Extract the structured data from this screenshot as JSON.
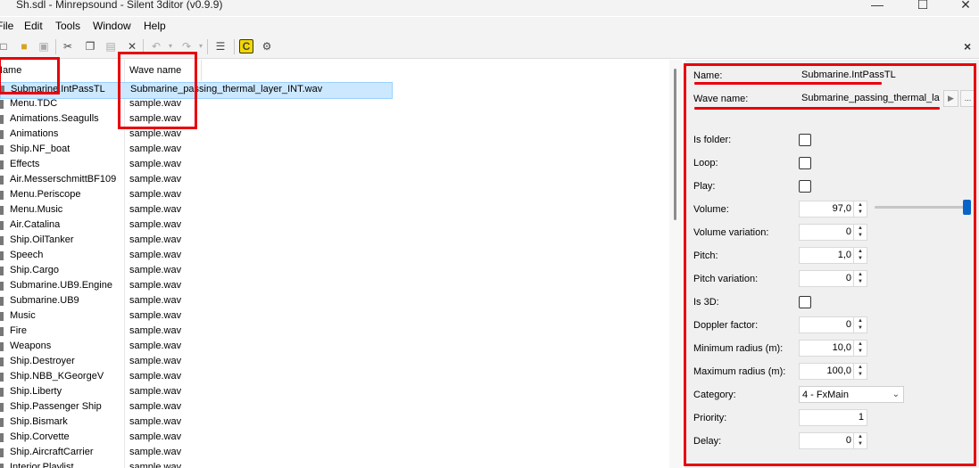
{
  "window": {
    "title": "Sh.sdl - Minrepsound - Silent 3ditor (v0.9.9)",
    "minimize": "—",
    "maximize": "☐",
    "close": "✕"
  },
  "menu": [
    "File",
    "Edit",
    "Tools",
    "Window",
    "Help"
  ],
  "panel_close": "×",
  "list": {
    "columns": [
      "Name",
      "Wave name"
    ],
    "rows": [
      {
        "name": "Submarine.IntPassTL",
        "wave": "Submarine_passing_thermal_layer_INT.wav",
        "selected": true
      },
      {
        "name": "Menu.TDC",
        "wave": "sample.wav"
      },
      {
        "name": "Animations.Seagulls",
        "wave": "sample.wav"
      },
      {
        "name": "Animations",
        "wave": "sample.wav"
      },
      {
        "name": "Ship.NF_boat",
        "wave": "sample.wav"
      },
      {
        "name": "Effects",
        "wave": "sample.wav"
      },
      {
        "name": "Air.MesserschmittBF109",
        "wave": "sample.wav"
      },
      {
        "name": "Menu.Periscope",
        "wave": "sample.wav"
      },
      {
        "name": "Menu.Music",
        "wave": "sample.wav"
      },
      {
        "name": "Air.Catalina",
        "wave": "sample.wav"
      },
      {
        "name": "Ship.OilTanker",
        "wave": "sample.wav"
      },
      {
        "name": "Speech",
        "wave": "sample.wav"
      },
      {
        "name": "Ship.Cargo",
        "wave": "sample.wav"
      },
      {
        "name": "Submarine.UB9.Engine",
        "wave": "sample.wav"
      },
      {
        "name": "Submarine.UB9",
        "wave": "sample.wav"
      },
      {
        "name": "Music",
        "wave": "sample.wav"
      },
      {
        "name": "Fire",
        "wave": "sample.wav"
      },
      {
        "name": "Weapons",
        "wave": "sample.wav"
      },
      {
        "name": "Ship.Destroyer",
        "wave": "sample.wav"
      },
      {
        "name": "Ship.NBB_KGeorgeV",
        "wave": "sample.wav"
      },
      {
        "name": "Ship.Liberty",
        "wave": "sample.wav"
      },
      {
        "name": "Ship.Passenger Ship",
        "wave": "sample.wav"
      },
      {
        "name": "Ship.Bismark",
        "wave": "sample.wav"
      },
      {
        "name": "Ship.Corvette",
        "wave": "sample.wav"
      },
      {
        "name": "Ship.AircraftCarrier",
        "wave": "sample.wav"
      },
      {
        "name": "Interior.Playlist",
        "wave": "sample.wav"
      }
    ]
  },
  "props": {
    "name_label": "Name:",
    "name_value": "Submarine.IntPassTL",
    "wave_label": "Wave name:",
    "wave_value": "Submarine_passing_thermal_layer_INT.wav",
    "play_btn": "▶",
    "browse_btn": "...",
    "is_folder_label": "Is folder:",
    "loop_label": "Loop:",
    "play_label": "Play:",
    "volume_label": "Volume:",
    "volume_value": "97,0",
    "volume_slider_level": 0.97,
    "volvar_label": "Volume variation:",
    "volvar_value": "0",
    "pitch_label": "Pitch:",
    "pitch_value": "1,0",
    "pitchvar_label": "Pitch variation:",
    "pitchvar_value": "0",
    "is3d_label": "Is 3D:",
    "doppler_label": "Doppler factor:",
    "doppler_value": "0",
    "minrad_label": "Minimum radius (m):",
    "minrad_value": "10,0",
    "maxrad_label": "Maximum radius (m):",
    "maxrad_value": "100,0",
    "category_label": "Category:",
    "category_value": "4 - FxMain",
    "priority_label": "Priority:",
    "priority_value": "1",
    "delay_label": "Delay:",
    "delay_value": "0"
  },
  "colors": {
    "annotation_red": "#e8000b",
    "selection": "#cce8ff",
    "slider_thumb": "#0a64c8"
  }
}
